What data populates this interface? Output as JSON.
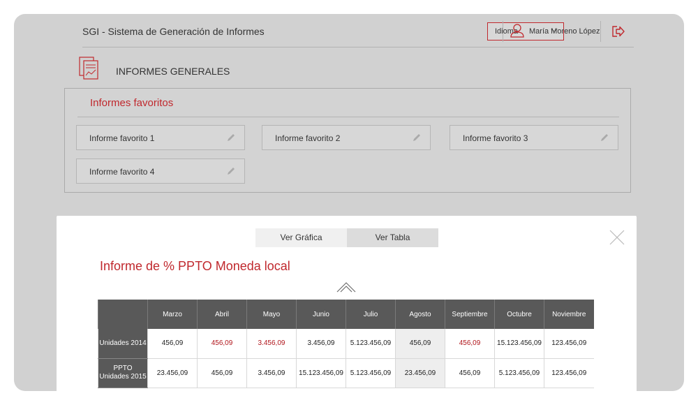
{
  "header": {
    "app_title": "SGI - Sistema de Generación de Informes",
    "language_select": "Idioma",
    "user_name": "María Moreno López"
  },
  "section": {
    "title": "INFORMES GENERALES"
  },
  "favorites": {
    "heading": "Informes favoritos",
    "items": [
      "Informe favorito 1",
      "Informe favorito 2",
      "Informe favorito 3",
      "Informe favorito 4"
    ]
  },
  "modal": {
    "tab_graph": "Ver Gráfica",
    "tab_table": "Ver Tabla",
    "report_title": "Informe de % PPTO Moneda local",
    "table": {
      "columns": [
        "Marzo",
        "Abril",
        "Mayo",
        "Junio",
        "Julio",
        "Agosto",
        "Septiembre",
        "Octubre",
        "Noviembre"
      ],
      "rows": [
        {
          "label": "Unidades 2014",
          "cells": [
            "456,09",
            "456,09",
            "3.456,09",
            "3.456,09",
            "5.123.456,09",
            "456,09",
            "456,09",
            "15.123.456,09",
            "123.456,09"
          ]
        },
        {
          "label": "PPTO Unidades 2015",
          "cells": [
            "23.456,09",
            "456,09",
            "3.456,09",
            "15.123.456,09",
            "5.123.456,09",
            "23.456,09",
            "456,09",
            "5.123.456,09",
            "123.456,09"
          ]
        }
      ]
    }
  },
  "colors": {
    "accent": "#c0282d",
    "header_dark": "#595959",
    "background": "#d1d1d1"
  }
}
